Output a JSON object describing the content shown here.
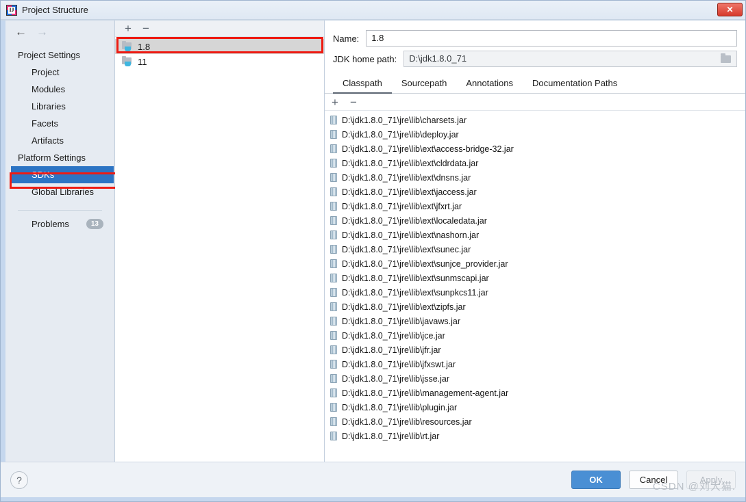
{
  "window": {
    "title": "Project Structure",
    "logo_icon": "intellij-idea-icon",
    "close_label": "✕"
  },
  "sidebar": {
    "back_icon": "←",
    "forward_icon": "→",
    "groups": [
      {
        "label": "Project Settings",
        "items": [
          {
            "label": "Project",
            "selected": false
          },
          {
            "label": "Modules",
            "selected": false
          },
          {
            "label": "Libraries",
            "selected": false
          },
          {
            "label": "Facets",
            "selected": false
          },
          {
            "label": "Artifacts",
            "selected": false
          }
        ]
      },
      {
        "label": "Platform Settings",
        "items": [
          {
            "label": "SDKs",
            "selected": true
          },
          {
            "label": "Global Libraries",
            "selected": false
          }
        ]
      }
    ],
    "problems": {
      "label": "Problems",
      "count": "13"
    }
  },
  "sdk_list": {
    "add_label": "+",
    "remove_label": "−",
    "items": [
      {
        "label": "1.8",
        "selected": true
      },
      {
        "label": "11",
        "selected": false
      }
    ]
  },
  "detail": {
    "name_label": "Name:",
    "name_value": "1.8",
    "jdk_home_label": "JDK home path:",
    "jdk_home_value": "D:\\jdk1.8.0_71",
    "browse_icon": "folder-icon",
    "tabs": [
      {
        "label": "Classpath",
        "active": true
      },
      {
        "label": "Sourcepath",
        "active": false
      },
      {
        "label": "Annotations",
        "active": false
      },
      {
        "label": "Documentation Paths",
        "active": false
      }
    ],
    "classpath_toolbar": {
      "add_label": "+",
      "remove_label": "−"
    },
    "classpath_entries": [
      "D:\\jdk1.8.0_71\\jre\\lib\\charsets.jar",
      "D:\\jdk1.8.0_71\\jre\\lib\\deploy.jar",
      "D:\\jdk1.8.0_71\\jre\\lib\\ext\\access-bridge-32.jar",
      "D:\\jdk1.8.0_71\\jre\\lib\\ext\\cldrdata.jar",
      "D:\\jdk1.8.0_71\\jre\\lib\\ext\\dnsns.jar",
      "D:\\jdk1.8.0_71\\jre\\lib\\ext\\jaccess.jar",
      "D:\\jdk1.8.0_71\\jre\\lib\\ext\\jfxrt.jar",
      "D:\\jdk1.8.0_71\\jre\\lib\\ext\\localedata.jar",
      "D:\\jdk1.8.0_71\\jre\\lib\\ext\\nashorn.jar",
      "D:\\jdk1.8.0_71\\jre\\lib\\ext\\sunec.jar",
      "D:\\jdk1.8.0_71\\jre\\lib\\ext\\sunjce_provider.jar",
      "D:\\jdk1.8.0_71\\jre\\lib\\ext\\sunmscapi.jar",
      "D:\\jdk1.8.0_71\\jre\\lib\\ext\\sunpkcs11.jar",
      "D:\\jdk1.8.0_71\\jre\\lib\\ext\\zipfs.jar",
      "D:\\jdk1.8.0_71\\jre\\lib\\javaws.jar",
      "D:\\jdk1.8.0_71\\jre\\lib\\jce.jar",
      "D:\\jdk1.8.0_71\\jre\\lib\\jfr.jar",
      "D:\\jdk1.8.0_71\\jre\\lib\\jfxswt.jar",
      "D:\\jdk1.8.0_71\\jre\\lib\\jsse.jar",
      "D:\\jdk1.8.0_71\\jre\\lib\\management-agent.jar",
      "D:\\jdk1.8.0_71\\jre\\lib\\plugin.jar",
      "D:\\jdk1.8.0_71\\jre\\lib\\resources.jar",
      "D:\\jdk1.8.0_71\\jre\\lib\\rt.jar"
    ]
  },
  "footer": {
    "help_label": "?",
    "ok_label": "OK",
    "cancel_label": "Cancel",
    "apply_label": "Apply",
    "watermark": "CSDN @刘大猫."
  },
  "colors": {
    "selection_blue": "#2c74c4",
    "annotation_red": "#ee1b12",
    "primary_button": "#4a8fd4",
    "close_red": "#d63a2c"
  }
}
